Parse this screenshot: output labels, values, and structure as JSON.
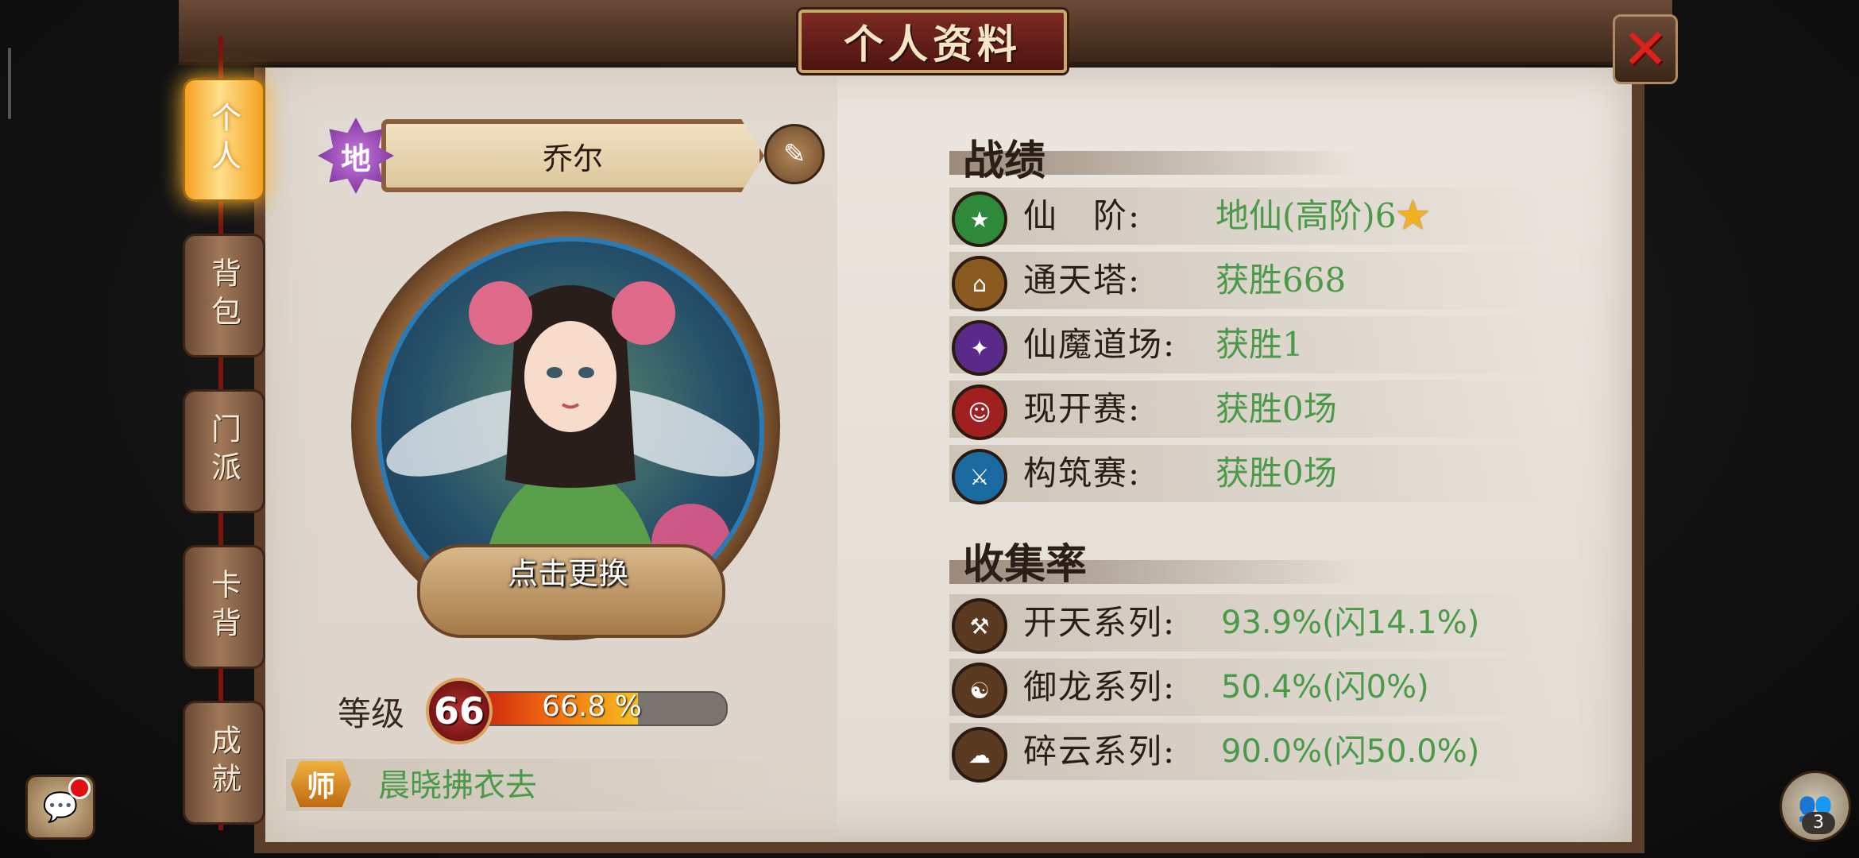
{
  "window": {
    "title": "个人资料"
  },
  "tabs": [
    {
      "label": "个人",
      "active": true
    },
    {
      "label": "背包",
      "active": false
    },
    {
      "label": "门派",
      "active": false
    },
    {
      "label": "卡背",
      "active": false
    },
    {
      "label": "成就",
      "active": false
    }
  ],
  "profile": {
    "rank_badge": "地",
    "name": "乔尔",
    "avatar_label": "点击更换",
    "level_label": "等级",
    "level": "66",
    "exp_percent_text": "66.8 %",
    "exp_fraction": 0.668,
    "mentor_badge": "师",
    "mentor_name": "晨晓拂衣去"
  },
  "record": {
    "title": "战绩",
    "rows": [
      {
        "label": "仙　阶:",
        "value": "地仙(高阶)6",
        "icon": "star-icon",
        "color": "#2e8a3a"
      },
      {
        "label": "通天塔:",
        "value": "获胜668",
        "icon": "tower-icon",
        "color": "#8a5a20"
      },
      {
        "label": "仙魔道场:",
        "value": "获胜1",
        "icon": "crane-icon",
        "color": "#5a2a8a"
      },
      {
        "label": "现开赛:",
        "value": "获胜0场",
        "icon": "face-icon",
        "color": "#a02020"
      },
      {
        "label": "构筑赛:",
        "value": "获胜0场",
        "icon": "sword-icon",
        "color": "#1a6aa0"
      }
    ]
  },
  "collection": {
    "title": "收集率",
    "rows": [
      {
        "label": "开天系列:",
        "value": "93.9%(闪14.1%)",
        "icon": "axe-icon"
      },
      {
        "label": "御龙系列:",
        "value": "50.4%(闪0%)",
        "icon": "dragon-icon"
      },
      {
        "label": "碎云系列:",
        "value": "90.0%(闪50.0%)",
        "icon": "cloud-icon"
      }
    ]
  },
  "side": {
    "friends_count": "3"
  },
  "colors": {
    "accent_green": "#4a9a4a",
    "frame_brown": "#5b3d2a",
    "tab_active": "#f4a020"
  }
}
